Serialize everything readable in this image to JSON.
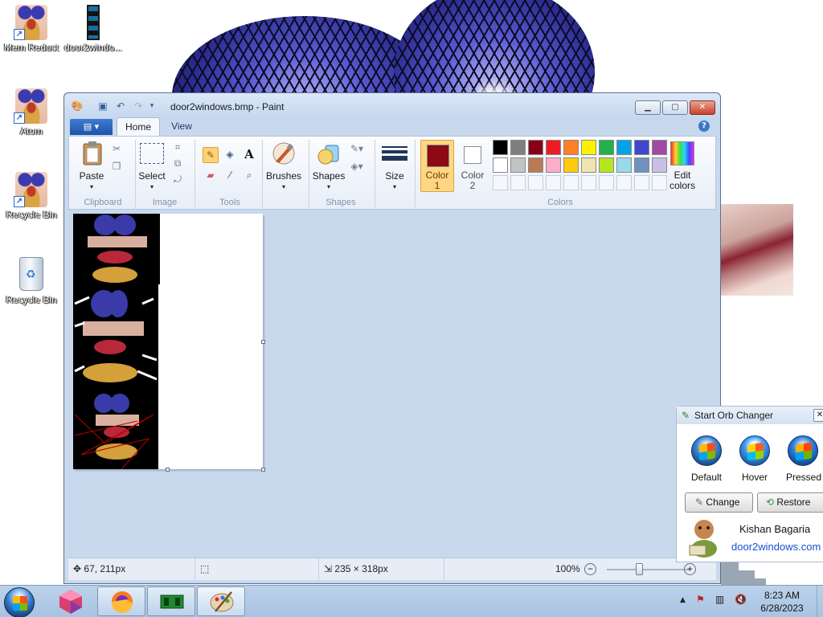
{
  "desktop": {
    "icons": [
      {
        "label": "Mem Reduct"
      },
      {
        "label": "door2windo..."
      },
      {
        "label": "Atom"
      },
      {
        "label": "Recycle Bin"
      },
      {
        "label": "Recycle Bin"
      }
    ]
  },
  "paint": {
    "title": "door2windows.bmp - Paint",
    "tabs": {
      "home": "Home",
      "view": "View"
    },
    "ribbon": {
      "clipboard": {
        "paste": "Paste",
        "group": "Clipboard"
      },
      "image": {
        "select": "Select",
        "group": "Image"
      },
      "tools": {
        "group": "Tools"
      },
      "shapes": {
        "brushes": "Brushes",
        "shapes": "Shapes",
        "group": "Shapes"
      },
      "size": {
        "label": "Size"
      },
      "colors": {
        "color1_line1": "Color",
        "color1_line2": "1",
        "color2_line1": "Color",
        "color2_line2": "2",
        "edit_line1": "Edit",
        "edit_line2": "colors",
        "group": "Colors",
        "color1_value": "#8b0a14",
        "color2_value": "#ffffff",
        "palette_row1": [
          "#000000",
          "#7f7f7f",
          "#880015",
          "#ed1c24",
          "#ff7f27",
          "#fff200",
          "#22b14c",
          "#00a2e8",
          "#3f48cc",
          "#a349a4"
        ],
        "palette_row2": [
          "#ffffff",
          "#c3c3c3",
          "#b97a57",
          "#ffaec9",
          "#ffc90e",
          "#efe4b0",
          "#b5e61d",
          "#99d9ea",
          "#7092be",
          "#c8bfe7"
        ]
      }
    },
    "status": {
      "cursor": "67, 211px",
      "image_size": "235 × 318px",
      "zoom": "100%"
    }
  },
  "orb_changer": {
    "title": "Start Orb Changer",
    "default": "Default",
    "hover": "Hover",
    "pressed": "Pressed",
    "change": "Change",
    "restore": "Restore",
    "author": "Kishan Bagaria",
    "site": "door2windows.com"
  },
  "taskbar": {
    "time": "8:23 AM",
    "date": "6/28/2023"
  }
}
